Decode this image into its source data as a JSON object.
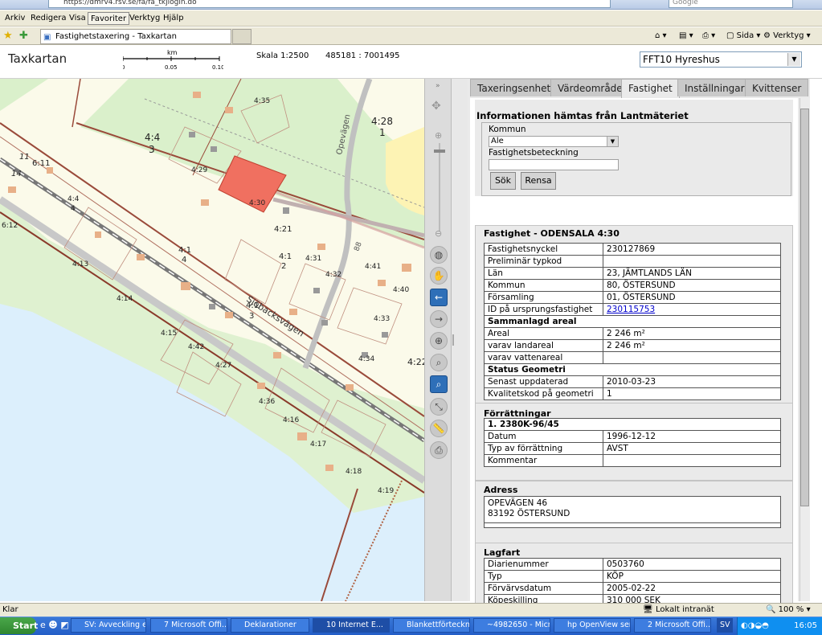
{
  "browser": {
    "address": "https://dmrv4.rsv.se/fa/fa_tkjlogin.do",
    "search_placeholder": "Google",
    "menus": [
      "Arkiv",
      "Redigera",
      "Visa",
      "Favoriter",
      "Verktyg",
      "Hjälp"
    ],
    "tab_title": "Fastighetstaxering - Taxkartan",
    "toolbar": {
      "sida": "Sida",
      "verktyg": "Verktyg"
    }
  },
  "app": {
    "title": "Taxkartan",
    "scale_unit": "km",
    "scale_ticks": [
      "0",
      "0.05",
      "0.10"
    ],
    "scale_text": "Skala 1:2500",
    "coords": "485181 : 7001495",
    "property_type": "FFT10 Hyreshus"
  },
  "map_labels": [
    "4:35",
    "4:28",
    "1",
    "4:4",
    "3",
    "4:29",
    "4:30",
    "6:11",
    "11",
    "14",
    "4:4",
    "4",
    "6:12",
    "4:21",
    "4:1",
    "4",
    "4:13",
    "4:1",
    "2",
    "4:31",
    "4:32",
    "4:41",
    "4:40",
    "4:14",
    "4:1",
    "3",
    "Sjöbacksvägen",
    "4:33",
    "4:15",
    "4:42",
    "4:27",
    "4:34",
    "4:22",
    "4:36",
    "4:16",
    "4:17",
    "4:18",
    "4:19",
    "Opevägen",
    "88"
  ],
  "tabs": [
    "Taxeringsenhet",
    "Värdeområde",
    "Fastighet",
    "Inställningar",
    "Kvittenser"
  ],
  "search": {
    "heading": "Informationen hämtas från Lantmäteriet",
    "kommun_label": "Kommun",
    "kommun_value": "Ale",
    "fb_label": "Fastighetsbeteckning",
    "sok": "Sök",
    "rensa": "Rensa"
  },
  "fastighet": {
    "heading": "Fastighet - ODENSALA 4:30",
    "rows": [
      {
        "k": "Fastighetsnyckel",
        "v": "230127869"
      },
      {
        "k": "Preliminär typkod",
        "v": ""
      },
      {
        "k": "Län",
        "v": "23, JÄMTLANDS LÄN"
      },
      {
        "k": "Kommun",
        "v": "80, ÖSTERSUND"
      },
      {
        "k": "Församling",
        "v": "01, ÖSTERSUND"
      },
      {
        "k": "ID på ursprungsfastighet",
        "v": "230115753"
      },
      {
        "k": "Sammanlagd areal",
        "v": ""
      },
      {
        "k": "Areal",
        "v": "2 246 m²"
      },
      {
        "k": "varav landareal",
        "v": "2 246 m²"
      },
      {
        "k": "varav vattenareal",
        "v": ""
      },
      {
        "k": "Status Geometri",
        "v": ""
      },
      {
        "k": "Senast uppdaterad",
        "v": "2010-03-23"
      },
      {
        "k": "Kvalitetskod på geometri",
        "v": "1"
      }
    ]
  },
  "forr": {
    "heading": "Förrättningar",
    "title": "1. 2380K-96/45",
    "rows": [
      {
        "k": "Datum",
        "v": "1996-12-12"
      },
      {
        "k": "Typ av förrättning",
        "v": "AVST"
      },
      {
        "k": "Kommentar",
        "v": ""
      }
    ]
  },
  "adress": {
    "heading": "Adress",
    "line1": "OPEVÄGEN 46",
    "line2": "83192 ÖSTERSUND"
  },
  "lagfart": {
    "heading": "Lagfart",
    "rows": [
      {
        "k": "Diarienummer",
        "v": "0503760"
      },
      {
        "k": "Typ",
        "v": "KÖP"
      },
      {
        "k": "Förvärvsdatum",
        "v": "2005-02-22"
      },
      {
        "k": "Köpeskilling",
        "v": "310 000 SEK"
      }
    ]
  },
  "statusbar": {
    "left": "Klar",
    "zone": "Lokalt intranät",
    "zoom": "100 %"
  },
  "taskbar": {
    "start": "Start",
    "items": [
      "SV: Avveckling e...",
      "7 Microsoft Offi...",
      "Deklarationer",
      "10 Internet E...",
      "Blankettförteckni...",
      "~4982650 - Micr...",
      "hp OpenView ser...",
      "2 Microsoft Offi..."
    ],
    "sv": "SV",
    "clock": "16:05"
  }
}
